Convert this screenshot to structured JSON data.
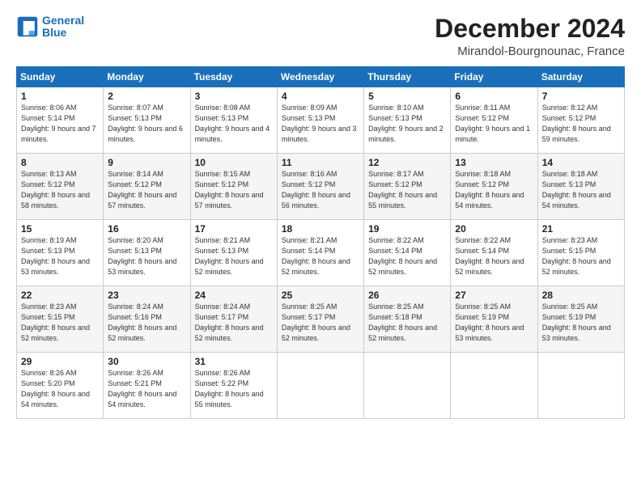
{
  "logo": {
    "line1": "General",
    "line2": "Blue"
  },
  "title": "December 2024",
  "location": "Mirandol-Bourgnounac, France",
  "days_header": [
    "Sunday",
    "Monday",
    "Tuesday",
    "Wednesday",
    "Thursday",
    "Friday",
    "Saturday"
  ],
  "weeks": [
    [
      {
        "num": "1",
        "sunrise": "Sunrise: 8:06 AM",
        "sunset": "Sunset: 5:14 PM",
        "daylight": "Daylight: 9 hours and 7 minutes."
      },
      {
        "num": "2",
        "sunrise": "Sunrise: 8:07 AM",
        "sunset": "Sunset: 5:13 PM",
        "daylight": "Daylight: 9 hours and 6 minutes."
      },
      {
        "num": "3",
        "sunrise": "Sunrise: 8:08 AM",
        "sunset": "Sunset: 5:13 PM",
        "daylight": "Daylight: 9 hours and 4 minutes."
      },
      {
        "num": "4",
        "sunrise": "Sunrise: 8:09 AM",
        "sunset": "Sunset: 5:13 PM",
        "daylight": "Daylight: 9 hours and 3 minutes."
      },
      {
        "num": "5",
        "sunrise": "Sunrise: 8:10 AM",
        "sunset": "Sunset: 5:13 PM",
        "daylight": "Daylight: 9 hours and 2 minutes."
      },
      {
        "num": "6",
        "sunrise": "Sunrise: 8:11 AM",
        "sunset": "Sunset: 5:12 PM",
        "daylight": "Daylight: 9 hours and 1 minute."
      },
      {
        "num": "7",
        "sunrise": "Sunrise: 8:12 AM",
        "sunset": "Sunset: 5:12 PM",
        "daylight": "Daylight: 8 hours and 59 minutes."
      }
    ],
    [
      {
        "num": "8",
        "sunrise": "Sunrise: 8:13 AM",
        "sunset": "Sunset: 5:12 PM",
        "daylight": "Daylight: 8 hours and 58 minutes."
      },
      {
        "num": "9",
        "sunrise": "Sunrise: 8:14 AM",
        "sunset": "Sunset: 5:12 PM",
        "daylight": "Daylight: 8 hours and 57 minutes."
      },
      {
        "num": "10",
        "sunrise": "Sunrise: 8:15 AM",
        "sunset": "Sunset: 5:12 PM",
        "daylight": "Daylight: 8 hours and 57 minutes."
      },
      {
        "num": "11",
        "sunrise": "Sunrise: 8:16 AM",
        "sunset": "Sunset: 5:12 PM",
        "daylight": "Daylight: 8 hours and 56 minutes."
      },
      {
        "num": "12",
        "sunrise": "Sunrise: 8:17 AM",
        "sunset": "Sunset: 5:12 PM",
        "daylight": "Daylight: 8 hours and 55 minutes."
      },
      {
        "num": "13",
        "sunrise": "Sunrise: 8:18 AM",
        "sunset": "Sunset: 5:12 PM",
        "daylight": "Daylight: 8 hours and 54 minutes."
      },
      {
        "num": "14",
        "sunrise": "Sunrise: 8:18 AM",
        "sunset": "Sunset: 5:13 PM",
        "daylight": "Daylight: 8 hours and 54 minutes."
      }
    ],
    [
      {
        "num": "15",
        "sunrise": "Sunrise: 8:19 AM",
        "sunset": "Sunset: 5:13 PM",
        "daylight": "Daylight: 8 hours and 53 minutes."
      },
      {
        "num": "16",
        "sunrise": "Sunrise: 8:20 AM",
        "sunset": "Sunset: 5:13 PM",
        "daylight": "Daylight: 8 hours and 53 minutes."
      },
      {
        "num": "17",
        "sunrise": "Sunrise: 8:21 AM",
        "sunset": "Sunset: 5:13 PM",
        "daylight": "Daylight: 8 hours and 52 minutes."
      },
      {
        "num": "18",
        "sunrise": "Sunrise: 8:21 AM",
        "sunset": "Sunset: 5:14 PM",
        "daylight": "Daylight: 8 hours and 52 minutes."
      },
      {
        "num": "19",
        "sunrise": "Sunrise: 8:22 AM",
        "sunset": "Sunset: 5:14 PM",
        "daylight": "Daylight: 8 hours and 52 minutes."
      },
      {
        "num": "20",
        "sunrise": "Sunrise: 8:22 AM",
        "sunset": "Sunset: 5:14 PM",
        "daylight": "Daylight: 8 hours and 52 minutes."
      },
      {
        "num": "21",
        "sunrise": "Sunrise: 8:23 AM",
        "sunset": "Sunset: 5:15 PM",
        "daylight": "Daylight: 8 hours and 52 minutes."
      }
    ],
    [
      {
        "num": "22",
        "sunrise": "Sunrise: 8:23 AM",
        "sunset": "Sunset: 5:15 PM",
        "daylight": "Daylight: 8 hours and 52 minutes."
      },
      {
        "num": "23",
        "sunrise": "Sunrise: 8:24 AM",
        "sunset": "Sunset: 5:16 PM",
        "daylight": "Daylight: 8 hours and 52 minutes."
      },
      {
        "num": "24",
        "sunrise": "Sunrise: 8:24 AM",
        "sunset": "Sunset: 5:17 PM",
        "daylight": "Daylight: 8 hours and 52 minutes."
      },
      {
        "num": "25",
        "sunrise": "Sunrise: 8:25 AM",
        "sunset": "Sunset: 5:17 PM",
        "daylight": "Daylight: 8 hours and 52 minutes."
      },
      {
        "num": "26",
        "sunrise": "Sunrise: 8:25 AM",
        "sunset": "Sunset: 5:18 PM",
        "daylight": "Daylight: 8 hours and 52 minutes."
      },
      {
        "num": "27",
        "sunrise": "Sunrise: 8:25 AM",
        "sunset": "Sunset: 5:19 PM",
        "daylight": "Daylight: 8 hours and 53 minutes."
      },
      {
        "num": "28",
        "sunrise": "Sunrise: 8:25 AM",
        "sunset": "Sunset: 5:19 PM",
        "daylight": "Daylight: 8 hours and 53 minutes."
      }
    ],
    [
      {
        "num": "29",
        "sunrise": "Sunrise: 8:26 AM",
        "sunset": "Sunset: 5:20 PM",
        "daylight": "Daylight: 8 hours and 54 minutes."
      },
      {
        "num": "30",
        "sunrise": "Sunrise: 8:26 AM",
        "sunset": "Sunset: 5:21 PM",
        "daylight": "Daylight: 8 hours and 54 minutes."
      },
      {
        "num": "31",
        "sunrise": "Sunrise: 8:26 AM",
        "sunset": "Sunset: 5:22 PM",
        "daylight": "Daylight: 8 hours and 55 minutes."
      },
      null,
      null,
      null,
      null
    ]
  ]
}
